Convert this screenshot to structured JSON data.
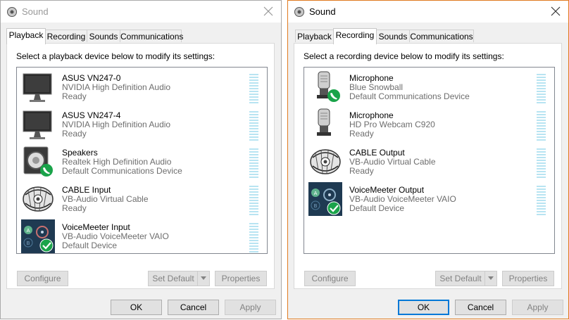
{
  "colors": {
    "meter": "#b8e4f2",
    "focus_border": "#e07a1f",
    "default_button": "#0078d7",
    "check_green": "#1aa34a"
  },
  "windows": [
    {
      "title": "Sound",
      "tabs": [
        {
          "label": "Playback"
        },
        {
          "label": "Recording"
        },
        {
          "label": "Sounds"
        },
        {
          "label": "Communications"
        }
      ],
      "active_tab": "Playback",
      "instruction": "Select a playback device below to modify its settings:",
      "devices": [
        {
          "name": "ASUS VN247-0",
          "desc": "NVIDIA High Definition Audio",
          "status": "Ready",
          "icon": "monitor-icon"
        },
        {
          "name": "ASUS VN247-4",
          "desc": "NVIDIA High Definition Audio",
          "status": "Ready",
          "icon": "monitor-icon"
        },
        {
          "name": "Speakers",
          "desc": "Realtek High Definition Audio",
          "status": "Default Communications Device",
          "icon": "speaker-icon"
        },
        {
          "name": "CABLE Input",
          "desc": "VB-Audio Virtual Cable",
          "status": "Ready",
          "icon": "cable-icon"
        },
        {
          "name": "VoiceMeeter Input",
          "desc": "VB-Audio VoiceMeeter VAIO",
          "status": "Default Device",
          "icon": "voicemeeter-icon"
        }
      ],
      "buttons": {
        "configure": "Configure",
        "set_default": "Set Default",
        "properties": "Properties",
        "ok": "OK",
        "cancel": "Cancel",
        "apply": "Apply"
      }
    },
    {
      "title": "Sound",
      "tabs": [
        {
          "label": "Playback"
        },
        {
          "label": "Recording"
        },
        {
          "label": "Sounds"
        },
        {
          "label": "Communications"
        }
      ],
      "active_tab": "Recording",
      "instruction": "Select a recording device below to modify its settings:",
      "devices": [
        {
          "name": "Microphone",
          "desc": "Blue Snowball",
          "status": "Default Communications Device",
          "icon": "microphone-icon"
        },
        {
          "name": "Microphone",
          "desc": "HD Pro Webcam C920",
          "status": "Ready",
          "icon": "microphone-icon"
        },
        {
          "name": "CABLE Output",
          "desc": "VB-Audio Virtual Cable",
          "status": "Ready",
          "icon": "cable-icon"
        },
        {
          "name": "VoiceMeeter Output",
          "desc": "VB-Audio VoiceMeeter VAIO",
          "status": "Default Device",
          "icon": "voicemeeter-icon"
        }
      ],
      "buttons": {
        "configure": "Configure",
        "set_default": "Set Default",
        "properties": "Properties",
        "ok": "OK",
        "cancel": "Cancel",
        "apply": "Apply"
      }
    }
  ]
}
